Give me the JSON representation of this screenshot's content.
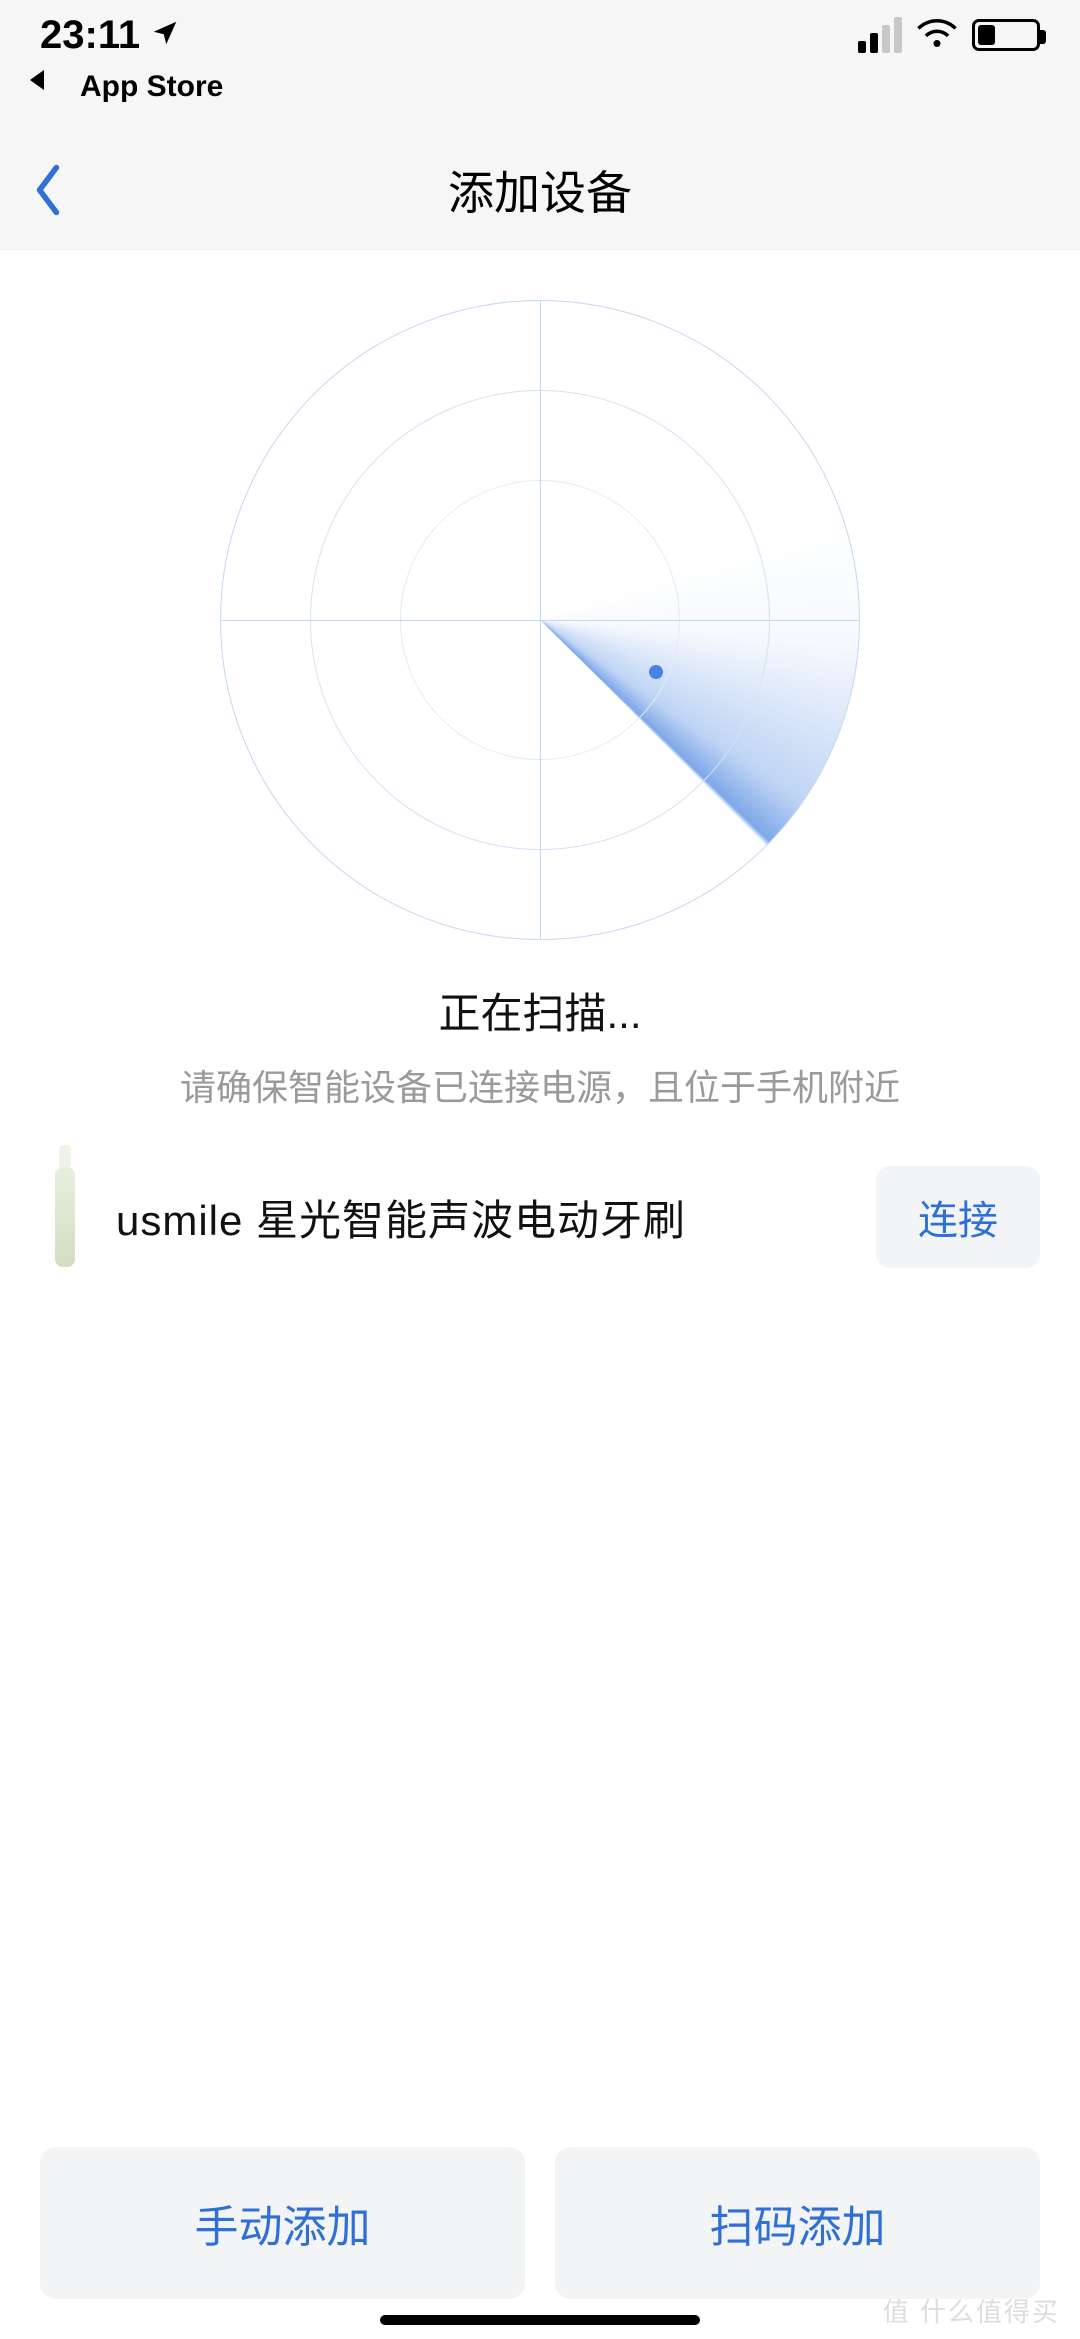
{
  "status_bar": {
    "time": "23:11",
    "back_to_app": "App Store"
  },
  "header": {
    "title": "添加设备"
  },
  "scan": {
    "title": "正在扫描...",
    "subtitle": "请确保智能设备已连接电源，且位于手机附近"
  },
  "device": {
    "name": "usmile 星光智能声波电动牙刷",
    "connect_label": "连接"
  },
  "bottom": {
    "manual_add": "手动添加",
    "scan_add": "扫码添加"
  },
  "watermark": "值 什么值得买"
}
